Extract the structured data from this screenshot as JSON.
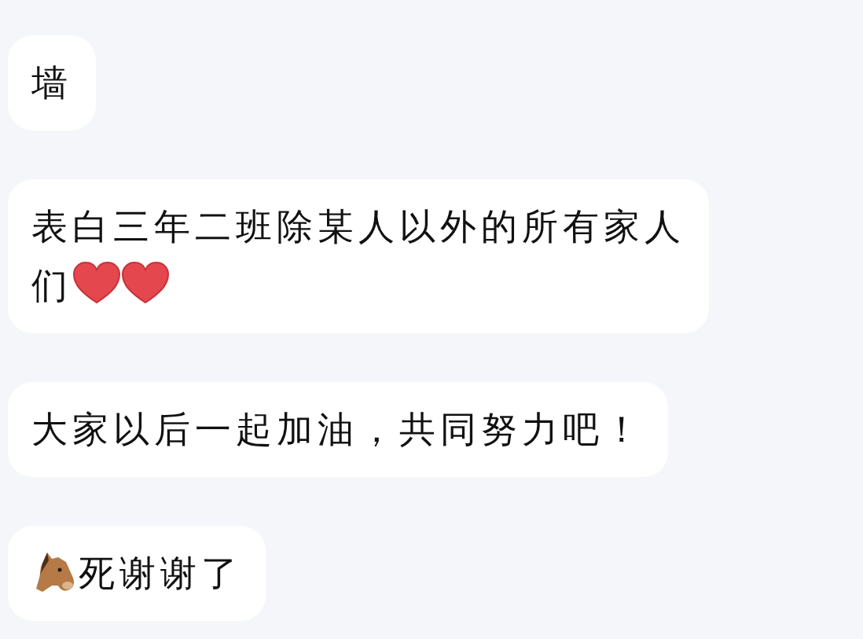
{
  "messages": [
    {
      "parts": [
        {
          "kind": "text",
          "text": "墙"
        }
      ]
    },
    {
      "parts": [
        {
          "kind": "text",
          "text": "表白三年二班除某人以外的所有家人们"
        },
        {
          "kind": "heart"
        },
        {
          "kind": "heart"
        }
      ]
    },
    {
      "parts": [
        {
          "kind": "text",
          "text": "大家以后一起加油，共同努力吧！"
        }
      ]
    },
    {
      "parts": [
        {
          "kind": "horse"
        },
        {
          "kind": "text",
          "text": "死谢谢了"
        }
      ]
    }
  ]
}
